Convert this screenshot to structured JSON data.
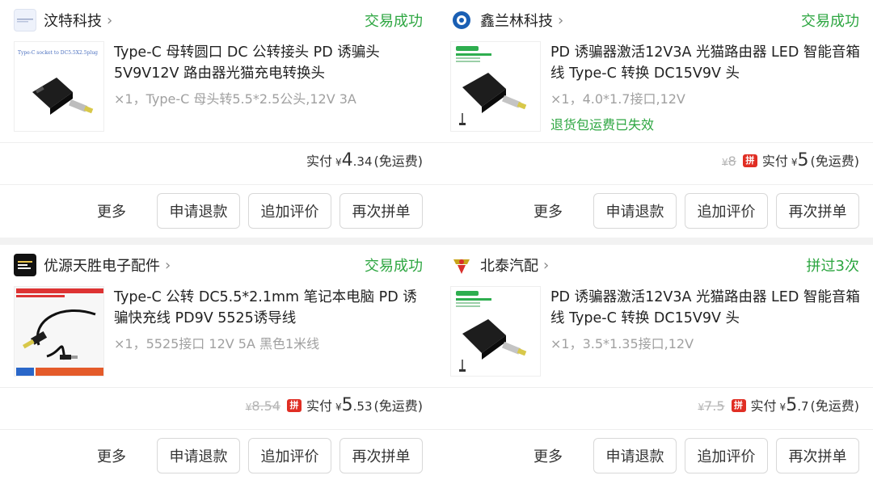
{
  "orders": [
    {
      "shop": "汶特科技",
      "status": "交易成功",
      "title": "Type-C 母转圆口 DC 公转接头 PD 诱骗头 5V9V12V 路由器光猫充电转换头",
      "spec": "×1，Type-C 母头转5.5*2.5公头,12V 3A",
      "notice": "",
      "orig_price": "",
      "paid_label": "实付",
      "yen": "¥",
      "price_int": "4",
      "price_dec": ".34",
      "shipping": "(免运费)",
      "thumb_caption": "Type-C socket to DC5.5X2.5plug"
    },
    {
      "shop": "鑫兰林科技",
      "status": "交易成功",
      "title": "PD 诱骗器激活12V3A 光猫路由器 LED 智能音箱线 Type-C 转换 DC15V9V 头",
      "spec": "×1，4.0*1.7接口,12V",
      "notice": "退货包运费已失效",
      "orig_price": "8",
      "paid_label": "实付",
      "yen": "¥",
      "price_int": "5",
      "price_dec": "",
      "shipping": "(免运费)",
      "thumb_caption": ""
    },
    {
      "shop": "优源天胜电子配件",
      "status": "交易成功",
      "title": "Type-C 公转 DC5.5*2.1mm 笔记本电脑 PD 诱骗快充线 PD9V 5525诱导线",
      "spec": "×1，5525接口 12V 5A 黑色1米线",
      "notice": "",
      "orig_price": "8.54",
      "paid_label": "实付",
      "yen": "¥",
      "price_int": "5",
      "price_dec": ".53",
      "shipping": "(免运费)",
      "thumb_caption": ""
    },
    {
      "shop": "北泰汽配",
      "status": "拼过3次",
      "title": "PD 诱骗器激活12V3A 光猫路由器 LED 智能音箱线 Type-C 转换 DC15V9V 头",
      "spec": "×1，3.5*1.35接口,12V",
      "notice": "",
      "orig_price": "7.5",
      "paid_label": "实付",
      "yen": "¥",
      "price_int": "5",
      "price_dec": ".7",
      "shipping": "(免运费)",
      "thumb_caption": ""
    }
  ],
  "actions": {
    "more": "更多",
    "refund": "申请退款",
    "review": "追加评价",
    "rebuy": "再次拼单"
  },
  "badge_text": "拼",
  "colors": {
    "status_green": "#2da641",
    "badge_red": "#e02e24",
    "strike_gray": "#b5b5b5"
  },
  "icons": [
    "chevron-right-icon",
    "shop-logo-icon",
    "discount-badge-icon"
  ]
}
